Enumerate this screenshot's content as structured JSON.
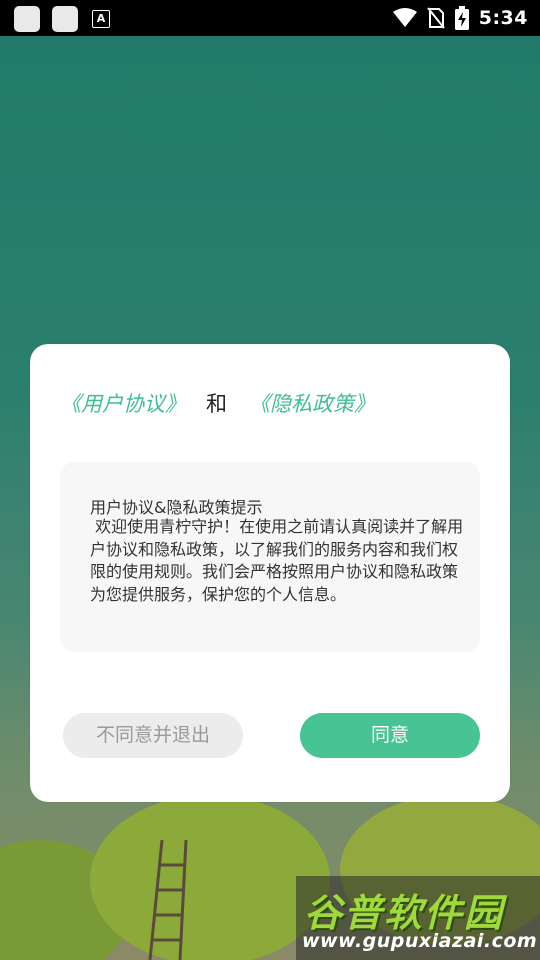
{
  "status_bar": {
    "time": "5:34",
    "icons": [
      "app-icon",
      "app-icon",
      "font-icon",
      "wifi-icon",
      "no-sim-icon",
      "battery-charging-icon"
    ]
  },
  "dialog": {
    "user_agreement_link": "《用户协议》",
    "and_text": "和",
    "privacy_policy_link": "《隐私政策》",
    "content_title": "用户协议&隐私政策提示",
    "content_body": " 欢迎使用青柠守护！在使用之前请认真阅读并了解用户协议和隐私政策，以了解我们的服务内容和我们权限的使用规则。我们会严格按照用户协议和隐私政策为您提供服务，保护您的个人信息。",
    "disagree_button": "不同意并退出",
    "agree_button": "同意"
  },
  "watermark": {
    "title": "谷普软件园",
    "url": "www.gupuxiazai.com"
  },
  "colors": {
    "accent": "#48c393",
    "link": "#3fbf92",
    "background_top": "#217a69"
  }
}
